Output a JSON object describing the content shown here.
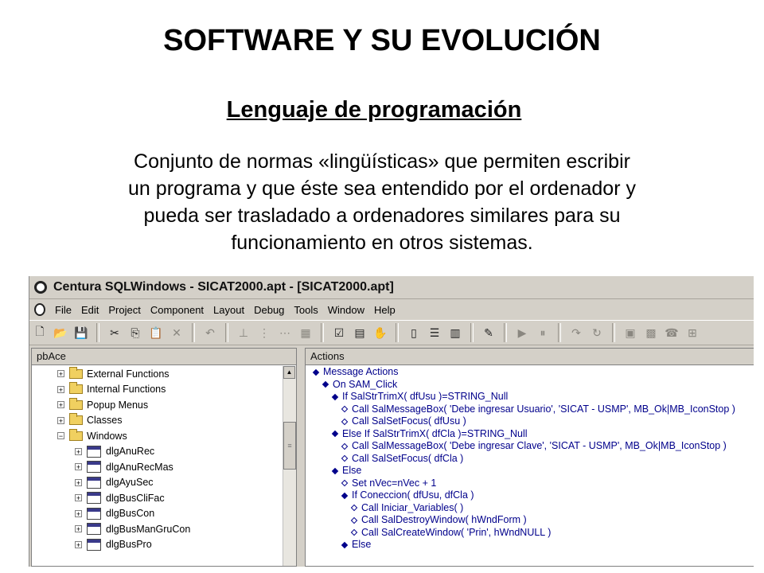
{
  "slide": {
    "title": "SOFTWARE Y SU EVOLUCIÓN",
    "subtitle": "Lenguaje de programación",
    "paragraph_lines": [
      "Conjunto de normas «lingüísticas» que permiten escribir",
      "un programa y que éste sea entendido por el ordenador y",
      "pueda ser trasladado a ordenadores similares para su",
      "funcionamiento en otros sistemas."
    ]
  },
  "app": {
    "window_title": "Centura SQLWindows - SICAT2000.apt - [SICAT2000.apt]",
    "menu": [
      "File",
      "Edit",
      "Project",
      "Component",
      "Layout",
      "Debug",
      "Tools",
      "Window",
      "Help"
    ],
    "toolbar_icons": [
      "new-icon",
      "open-icon",
      "save-icon",
      "sep",
      "cut-icon",
      "copy-icon",
      "paste-icon",
      "delete-icon",
      "sep",
      "undo-icon",
      "sep",
      "align-icon",
      "distribute-icon",
      "grid-icon",
      "table-icon",
      "sep",
      "check-icon",
      "outline-icon",
      "hand-icon",
      "sep",
      "form-icon",
      "list-icon",
      "grid-window-icon",
      "sep",
      "wand-icon",
      "sep",
      "run-icon",
      "pause-icon",
      "sep",
      "step-icon",
      "step-over-icon",
      "sep",
      "calc-icon",
      "db-icon",
      "phone-icon",
      "debug-icon"
    ],
    "left_pane": {
      "header": "pbAce",
      "tree": [
        {
          "label": "External Functions",
          "expander": "+",
          "icon": "folder-icon",
          "indent": 0
        },
        {
          "label": "Internal Functions",
          "expander": "+",
          "icon": "folder-icon",
          "indent": 0
        },
        {
          "label": "Popup Menus",
          "expander": "+",
          "icon": "folder-icon",
          "indent": 0
        },
        {
          "label": "Classes",
          "expander": "+",
          "icon": "folder-icon",
          "indent": 0
        },
        {
          "label": "Windows",
          "expander": "−",
          "icon": "folder-icon",
          "indent": 0
        },
        {
          "label": "dlgAnuRec",
          "expander": "+",
          "icon": "dialog-icon",
          "indent": 1
        },
        {
          "label": "dlgAnuRecMas",
          "expander": "+",
          "icon": "dialog-icon",
          "indent": 1
        },
        {
          "label": "dlgAyuSec",
          "expander": "+",
          "icon": "dialog-icon",
          "indent": 1
        },
        {
          "label": "dlgBusCliFac",
          "expander": "+",
          "icon": "dialog-icon",
          "indent": 1
        },
        {
          "label": "dlgBusCon",
          "expander": "+",
          "icon": "dialog-icon",
          "indent": 1
        },
        {
          "label": "dlgBusManGruCon",
          "expander": "+",
          "icon": "dialog-icon",
          "indent": 1
        },
        {
          "label": "dlgBusPro",
          "expander": "+",
          "icon": "dialog-icon",
          "indent": 1
        }
      ]
    },
    "right_pane": {
      "header": "Actions",
      "code": [
        {
          "text": "Message Actions",
          "level": 0,
          "bullet": "filled"
        },
        {
          "text": "On SAM_Click",
          "level": 1,
          "bullet": "filled"
        },
        {
          "text": "If SalStrTrimX( dfUsu )=STRING_Null",
          "level": 2,
          "bullet": "filled"
        },
        {
          "text": "Call SalMessageBox( 'Debe ingresar Usuario', 'SICAT - USMP', MB_Ok|MB_IconStop )",
          "level": 3,
          "bullet": "hollow"
        },
        {
          "text": "Call SalSetFocus( dfUsu )",
          "level": 3,
          "bullet": "hollow"
        },
        {
          "text": "Else If SalStrTrimX( dfCla )=STRING_Null",
          "level": 2,
          "bullet": "filled"
        },
        {
          "text": "Call SalMessageBox( 'Debe ingresar Clave', 'SICAT - USMP', MB_Ok|MB_IconStop )",
          "level": 3,
          "bullet": "hollow"
        },
        {
          "text": "Call SalSetFocus( dfCla )",
          "level": 3,
          "bullet": "hollow"
        },
        {
          "text": "Else",
          "level": 2,
          "bullet": "filled"
        },
        {
          "text": "Set nVec=nVec + 1",
          "level": 3,
          "bullet": "hollow"
        },
        {
          "text": "If Coneccion( dfUsu, dfCla )",
          "level": 3,
          "bullet": "filled"
        },
        {
          "text": "Call Iniciar_Variables( )",
          "level": 4,
          "bullet": "hollow"
        },
        {
          "text": "Call SalDestroyWindow( hWndForm )",
          "level": 4,
          "bullet": "hollow"
        },
        {
          "text": "Call SalCreateWindow( 'Prin', hWndNULL )",
          "level": 4,
          "bullet": "hollow"
        },
        {
          "text": "Else",
          "level": 3,
          "bullet": "filled"
        }
      ]
    }
  }
}
